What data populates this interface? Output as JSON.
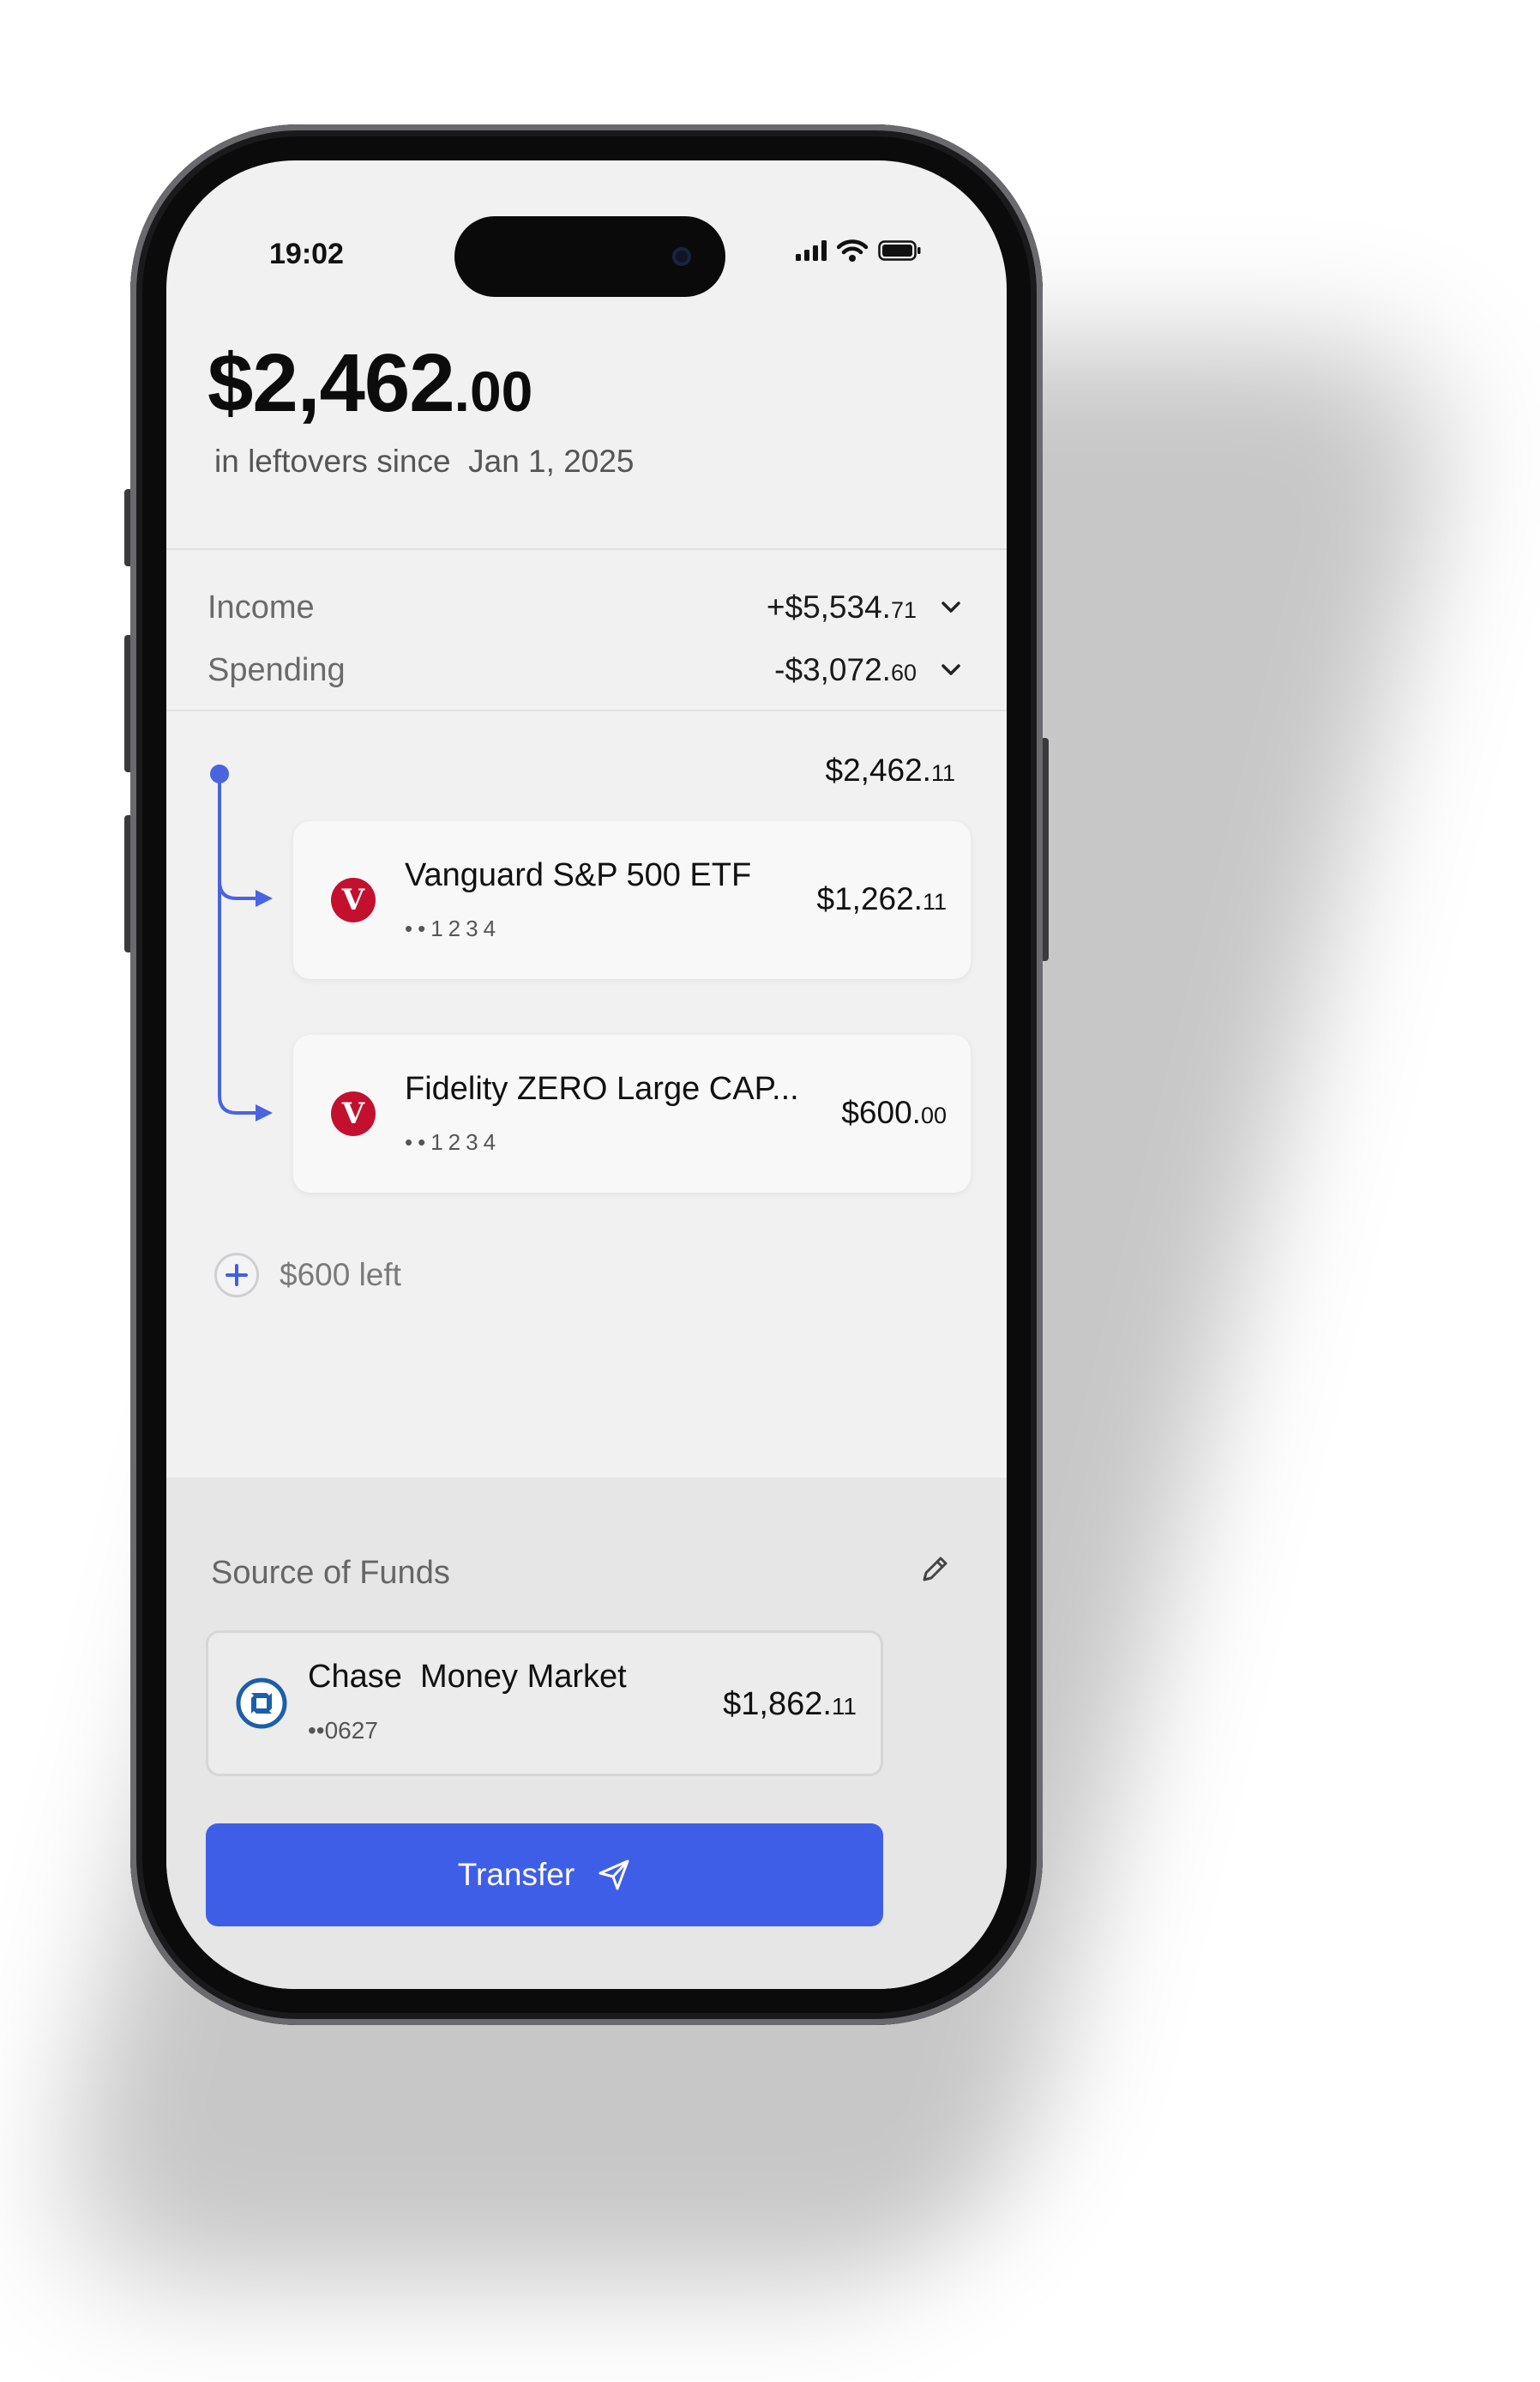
{
  "status_bar": {
    "time": "19:02"
  },
  "header": {
    "amount_whole": "$2,462",
    "amount_cents": ".00",
    "subtitle": "in leftovers since  Jan 1, 2025"
  },
  "summary": {
    "income": {
      "label": "Income",
      "value_main": "+$5,534.",
      "value_cents": "71"
    },
    "spending": {
      "label": "Spending",
      "value_main": "-$3,072.",
      "value_cents": "60"
    }
  },
  "allocation": {
    "total_main": "$2,462.",
    "total_cents": "11",
    "items": [
      {
        "name": "Vanguard S&P 500 ETF",
        "mask": "••1234",
        "amount_main": "$1,262.",
        "amount_cents": "11",
        "logo_letter": "V"
      },
      {
        "name": "Fidelity ZERO Large CAP...",
        "mask": "••1234",
        "amount_main": "$600.",
        "amount_cents": "00",
        "logo_letter": "V"
      }
    ],
    "remaining_label": "$600 left"
  },
  "source_of_funds": {
    "title": "Source of Funds",
    "account_name": "Chase  Money Market",
    "mask": "••0627",
    "amount_main": "$1,862.",
    "amount_cents": "11"
  },
  "actions": {
    "transfer_label": "Transfer"
  },
  "colors": {
    "accent": "#3f5ee8",
    "tree_line": "#4a63e0",
    "vanguard_red": "#c4102f",
    "chase_blue": "#1b5fa8"
  },
  "icons": {
    "income_chevron": "chevron-down-icon",
    "spending_chevron": "chevron-down-icon",
    "add": "plus-icon",
    "edit": "pencil-icon",
    "transfer": "send-icon"
  }
}
